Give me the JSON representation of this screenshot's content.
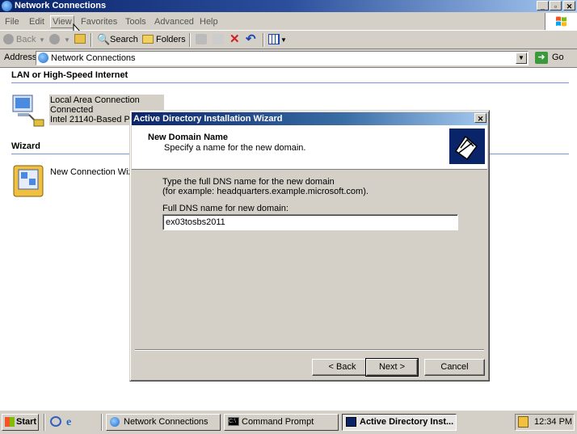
{
  "window": {
    "title": "Network Connections"
  },
  "menu": [
    "File",
    "Edit",
    "View",
    "Favorites",
    "Tools",
    "Advanced",
    "Help"
  ],
  "toolbar": {
    "back": "Back",
    "search": "Search",
    "folders": "Folders"
  },
  "address": {
    "label": "Address",
    "value": "Network Connections",
    "go": "Go"
  },
  "content": {
    "group1": "LAN or High-Speed Internet",
    "lan_name": "Local Area Connection",
    "lan_status": "Connected",
    "lan_device": "Intel 21140-Based PCI",
    "group2": "Wizard",
    "wizard_item": "New Connection Wizard"
  },
  "dialog": {
    "title": "Active Directory Installation Wizard",
    "header_title": "New Domain Name",
    "header_subtitle": "Specify a name for the new domain.",
    "instruction_line1": "Type the full DNS name for the new domain",
    "instruction_line2": "(for example: headquarters.example.microsoft.com).",
    "field_label": "Full DNS name for new domain:",
    "field_value": "ex03tosbs2011",
    "back_button": "< Back",
    "next_button": "Next >",
    "cancel_button": "Cancel"
  },
  "taskbar": {
    "start": "Start",
    "tasks": [
      "Network Connections",
      "Command Prompt",
      "Active Directory Inst..."
    ],
    "clock": "12:34 PM"
  },
  "colors": {
    "titlebar": "#0a246a",
    "face": "#d4d0c8"
  }
}
